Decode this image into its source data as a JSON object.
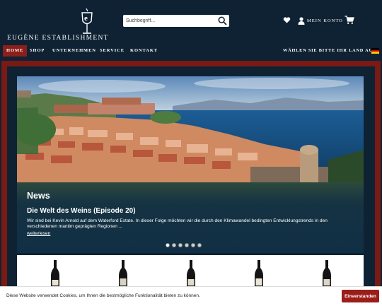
{
  "brand": {
    "name": "Eugène Establishment",
    "logo_icon": "wine-glass-e-logo"
  },
  "search": {
    "placeholder": "Suchbegriff...",
    "icon": "search-icon"
  },
  "account": {
    "label": "Mein Konto"
  },
  "icons": {
    "wishlist": "heart-icon",
    "account": "user-icon",
    "cart": "cart-icon"
  },
  "nav": {
    "items": [
      {
        "label": "Home",
        "active": true
      },
      {
        "label": "Shop",
        "active": false
      },
      {
        "label": "Unternehmen",
        "active": false
      },
      {
        "label": "Service",
        "active": false
      },
      {
        "label": "Kontakt",
        "active": false
      }
    ],
    "country_label": "Wählen Sie bitte Ihr Land aus",
    "flag": "germany-flag"
  },
  "slider": {
    "section_title": "News",
    "heading": "Die Welt des Weins (Episode 20)",
    "text": "Wir sind bei Kevin Arnold auf dem Waterford Estate. In dieser Folge möchten wir die durch den Klimawandel bedingten Entwicklungstrends in den verschiedenen mantim geprägten Regionen ...",
    "link_label": "weiterlesen",
    "slide_count": 6,
    "active_slide": 1
  },
  "cookie": {
    "text": "Diese Website verwendet Cookies, um Ihnen die bestmögliche Funktionalität bieten zu können.",
    "button_label": "Einverstanden"
  },
  "colors": {
    "navy": "#0f2233",
    "accent_red": "#8b1f1a",
    "white": "#ffffff"
  }
}
